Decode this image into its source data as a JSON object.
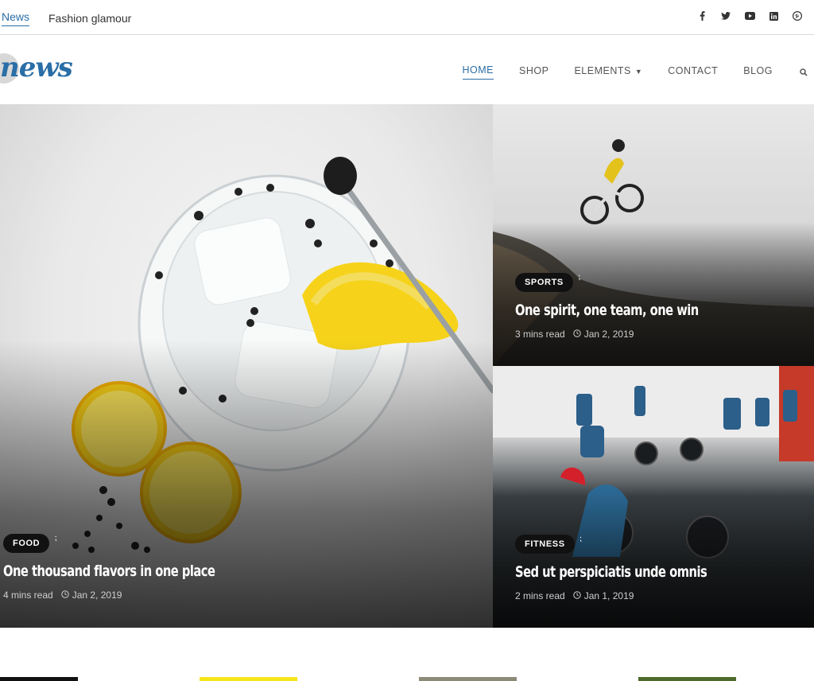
{
  "topbar": {
    "label": "News",
    "ticker": "Fashion glamour",
    "social_icons": [
      "facebook-icon",
      "twitter-icon",
      "youtube-icon",
      "linkedin-icon",
      "pinterest-icon"
    ]
  },
  "brand": {
    "logo_text": "news",
    "color": "#2a6ea6"
  },
  "nav": {
    "items": [
      {
        "label": "HOME",
        "active": true
      },
      {
        "label": "SHOP"
      },
      {
        "label": "ELEMENTS",
        "dropdown": true
      },
      {
        "label": "CONTACT"
      },
      {
        "label": "BLOG"
      }
    ],
    "search_icon": "search-icon"
  },
  "posts": [
    {
      "category": "FOOD",
      "title": "One thousand flavors in one place",
      "read_time": "4 mins read",
      "date": "Jan 2, 2019"
    },
    {
      "category": "SPORTS",
      "title": "One spirit, one team, one win",
      "read_time": "3 mins read",
      "date": "Jan 2, 2019"
    },
    {
      "category": "FITNESS",
      "title": "Sed ut perspiciatis unde omnis",
      "read_time": "2 mins read",
      "date": "Jan 1, 2019"
    }
  ],
  "colors": {
    "accent": "#2a6ea6",
    "badge": "#111111",
    "lemon": "#f6d31a"
  }
}
